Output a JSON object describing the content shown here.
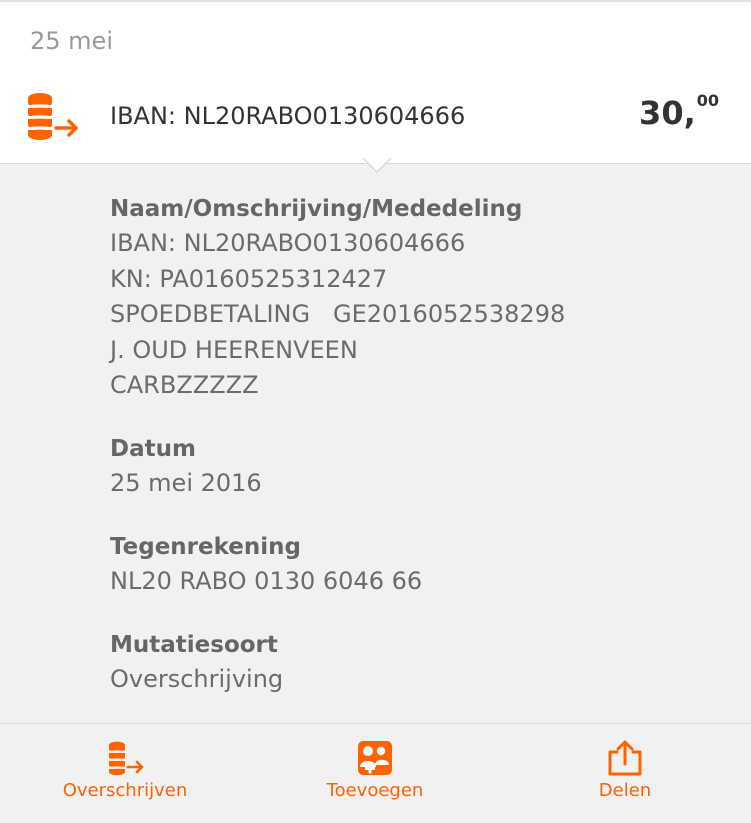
{
  "header": {
    "date": "25 mei"
  },
  "transaction": {
    "icon": "coins-transfer-icon",
    "iban_label": "IBAN: NL20RABO0130604666",
    "amount_whole": "30,",
    "amount_cents": "00"
  },
  "details": {
    "description": {
      "label": "Naam/Omschrijving/Mededeling",
      "lines": [
        "IBAN: NL20RABO0130604666",
        "KN: PA0160525312427",
        "SPOEDBETALING   GE2016052538298",
        "J. OUD HEERENVEEN",
        "CARBZZZZZ"
      ]
    },
    "date": {
      "label": "Datum",
      "value": "25 mei 2016"
    },
    "counter_account": {
      "label": "Tegenrekening",
      "value": "NL20 RABO 0130 6046 66"
    },
    "mutation_type": {
      "label": "Mutatiesoort",
      "value": "Overschrijving"
    }
  },
  "actions": [
    {
      "label": "Overschrijven",
      "icon": "transfer-icon"
    },
    {
      "label": "Toevoegen",
      "icon": "contacts-add-icon"
    },
    {
      "label": "Delen",
      "icon": "share-icon"
    }
  ],
  "colors": {
    "accent": "#ff6200",
    "background_details": "#f1f1f1",
    "text_primary": "#333333",
    "text_secondary": "#6b6b6b"
  }
}
